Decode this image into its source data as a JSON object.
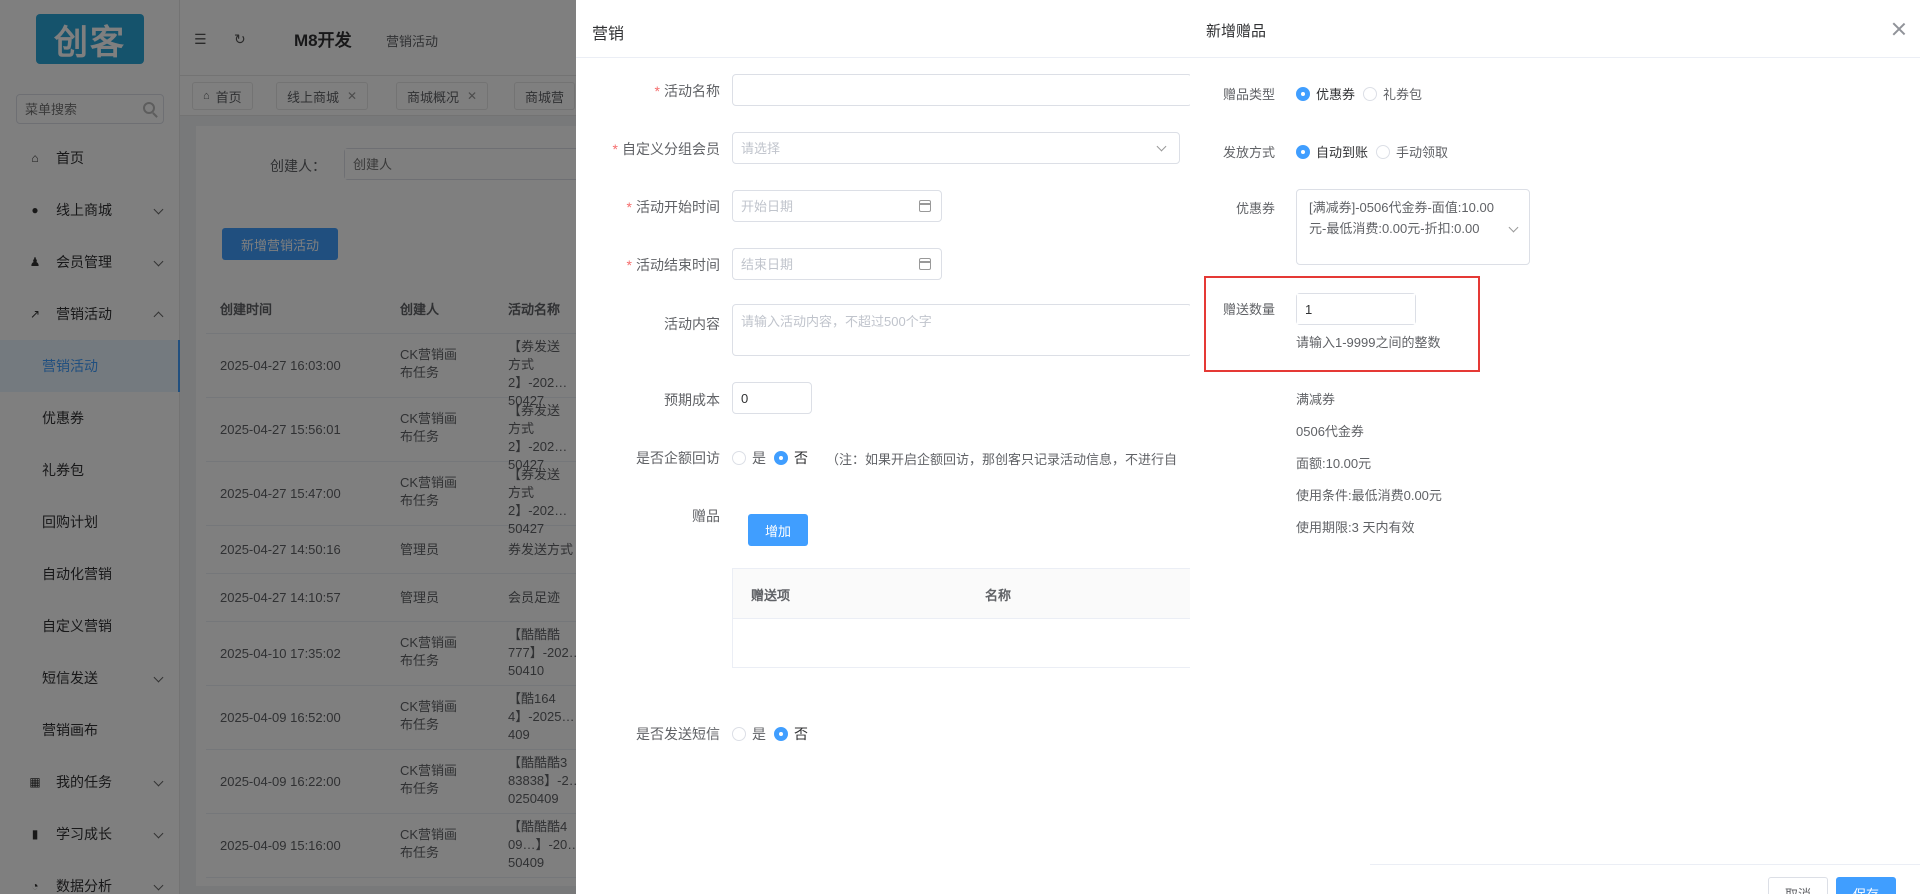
{
  "sidebar": {
    "logo": "创客",
    "search_placeholder": "菜单搜索",
    "items": [
      {
        "label": "首页",
        "icon": "home-icon"
      },
      {
        "label": "线上商城",
        "icon": "shop-icon"
      },
      {
        "label": "会员管理",
        "icon": "user-icon"
      },
      {
        "label": "营销活动",
        "icon": "trend-icon"
      },
      {
        "label": "营销活动"
      },
      {
        "label": "优惠券"
      },
      {
        "label": "礼券包"
      },
      {
        "label": "回购计划"
      },
      {
        "label": "自动化营销"
      },
      {
        "label": "自定义营销"
      },
      {
        "label": "短信发送"
      },
      {
        "label": "营销画布"
      },
      {
        "label": "我的任务",
        "icon": "grid-icon"
      },
      {
        "label": "学习成长",
        "icon": "book-icon"
      },
      {
        "label": "数据分析",
        "icon": "chart-icon"
      }
    ]
  },
  "header": {
    "app_title": "M8开发",
    "breadcrumb": "营销活动"
  },
  "tabs": [
    {
      "label": "首页"
    },
    {
      "label": "线上商城"
    },
    {
      "label": "商城概况"
    },
    {
      "label": "商城营"
    }
  ],
  "filter": {
    "creator_label": "创建人：",
    "creator_placeholder": "创建人"
  },
  "new_button": "新增营销活动",
  "table": {
    "columns": [
      "创建时间",
      "创建人",
      "活动名称"
    ],
    "rows": [
      {
        "time": "2025-04-27 16:03:00",
        "creator": "CK营销画布任务",
        "name": "【券发送方式2】-202…50427"
      },
      {
        "time": "2025-04-27 15:56:01",
        "creator": "CK营销画布任务",
        "name": "【券发送方式2】-202…50427"
      },
      {
        "time": "2025-04-27 15:47:00",
        "creator": "CK营销画布任务",
        "name": "【券发送方式2】-202…50427"
      },
      {
        "time": "2025-04-27 14:50:16",
        "creator": "管理员",
        "name": "券发送方式"
      },
      {
        "time": "2025-04-27 14:10:57",
        "creator": "管理员",
        "name": "会员足迹"
      },
      {
        "time": "2025-04-10 17:35:02",
        "creator": "CK营销画布任务",
        "name": "【酷酷酷777】-202…50410"
      },
      {
        "time": "2025-04-09 16:52:00",
        "creator": "CK营销画布任务",
        "name": "【酷164 4】-2025…409"
      },
      {
        "time": "2025-04-09 16:22:00",
        "creator": "CK营销画布任务",
        "name": "【酷酷酷3 83838】-2…0250409"
      },
      {
        "time": "2025-04-09 15:16:00",
        "creator": "CK营销画布任务",
        "name": "【酷酷酷4 09…】-20…50409"
      }
    ]
  },
  "drawer1": {
    "title": "营销",
    "fields": {
      "name_label": "活动名称",
      "group_label": "自定义分组会员",
      "group_placeholder": "请选择",
      "start_label": "活动开始时间",
      "start_placeholder": "开始日期",
      "end_label": "活动结束时间",
      "end_placeholder": "结束日期",
      "content_label": "活动内容",
      "content_placeholder": "请输入活动内容，不超过500个字",
      "cost_label": "预期成本",
      "cost_value": "0",
      "revisit_label": "是否企额回访",
      "revisit_yes": "是",
      "revisit_no": "否",
      "revisit_note": "（注：如果开启企额回访，那创客只记录活动信息，不进行自",
      "gift_label": "赠品",
      "add_button": "增加",
      "gift_col1": "赠送项",
      "gift_col2": "名称",
      "sms_label": "是否发送短信",
      "sms_yes": "是",
      "sms_no": "否"
    }
  },
  "drawer2": {
    "title": "新增赠品",
    "gift_type_label": "赠品类型",
    "gift_type_options": [
      "优惠券",
      "礼券包"
    ],
    "gift_type_selected": "优惠券",
    "issue_label": "发放方式",
    "issue_options": [
      "自动到账",
      "手动领取"
    ],
    "issue_selected": "自动到账",
    "coupon_label": "优惠券",
    "coupon_value": "[满减券]-0506代金券-面值:10.00元-最低消费:0.00元-折扣:0.00",
    "qty_label": "赠送数量",
    "qty_value": "1",
    "qty_hint": "请输入1-9999之间的整数",
    "coupon_info": [
      "满减券",
      "0506代金券",
      "面额:10.00元",
      "使用条件:最低消费0.00元",
      "使用期限:3 天内有效"
    ],
    "cancel_button": "取消",
    "save_button": "保存"
  }
}
